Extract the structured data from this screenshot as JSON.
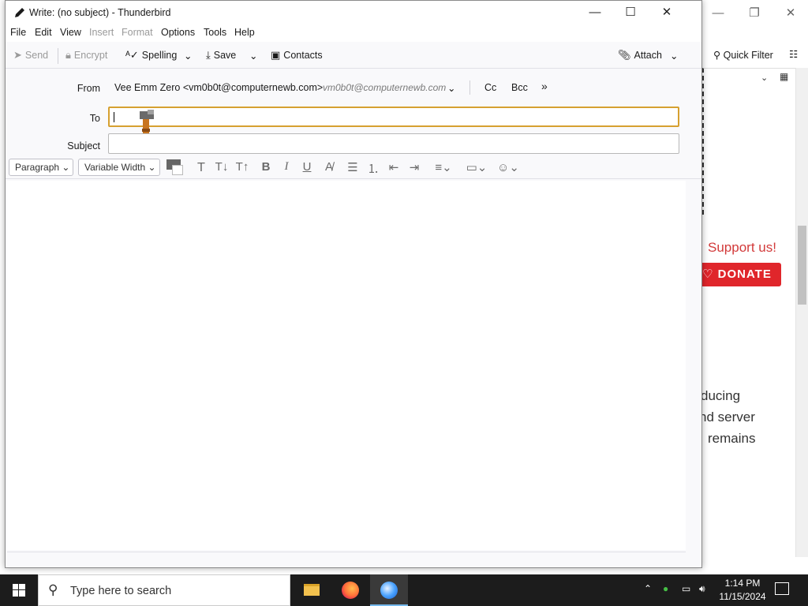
{
  "window": {
    "title": "Write: (no subject) - Thunderbird",
    "minimize": "—",
    "maximize": "☐",
    "close": "✕"
  },
  "menubar": {
    "items": [
      {
        "label": "File",
        "enabled": true
      },
      {
        "label": "Edit",
        "enabled": true
      },
      {
        "label": "View",
        "enabled": true
      },
      {
        "label": "Insert",
        "enabled": false
      },
      {
        "label": "Format",
        "enabled": false
      },
      {
        "label": "Options",
        "enabled": true
      },
      {
        "label": "Tools",
        "enabled": true
      },
      {
        "label": "Help",
        "enabled": true
      }
    ]
  },
  "toolbar": {
    "send": "Send",
    "encrypt": "Encrypt",
    "spelling": "Spelling",
    "save": "Save",
    "contacts": "Contacts",
    "attach": "Attach"
  },
  "headers": {
    "from_label": "From",
    "from_value": "Vee Emm Zero <vm0b0t@computernewb.com>",
    "from_email": "vm0b0t@computernewb.com",
    "cc": "Cc",
    "bcc": "Bcc",
    "more": "»",
    "to_label": "To",
    "to_value": "",
    "subject_label": "Subject",
    "subject_value": ""
  },
  "format_bar": {
    "paragraph": "Paragraph",
    "font": "Variable Width"
  },
  "background": {
    "quick_filter": "Quick Filter",
    "support": "Support us!",
    "donate": "♡ DONATE",
    "text_lines": [
      "ducing",
      "nd server",
      "remains"
    ]
  },
  "taskbar": {
    "search_placeholder": "Type here to search",
    "time": "1:14 PM",
    "date": "11/15/2024"
  }
}
